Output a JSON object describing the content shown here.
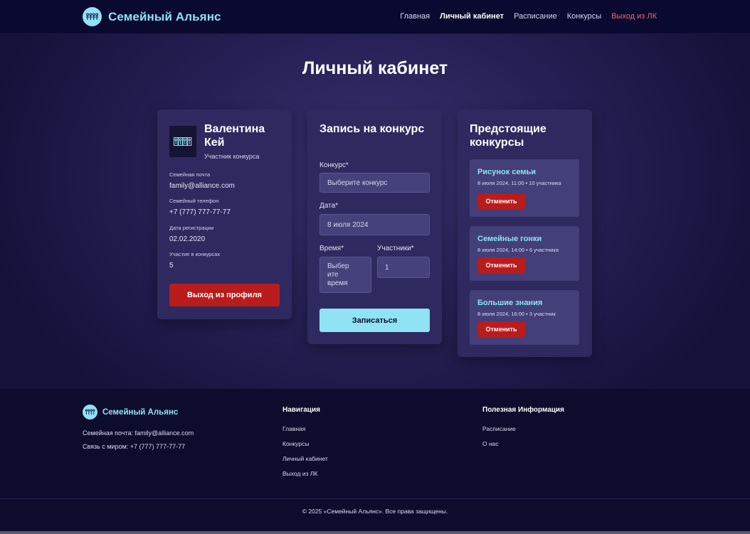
{
  "brand": {
    "name": "Семейный Альянс",
    "logo_icon": "family-group-icon",
    "accent_color": "#8fe3f5"
  },
  "nav": {
    "items": [
      {
        "label": "Главная",
        "state": "normal"
      },
      {
        "label": "Личный кабинет",
        "state": "active"
      },
      {
        "label": "Расписание",
        "state": "normal"
      },
      {
        "label": "Конкурсы",
        "state": "normal"
      },
      {
        "label": "Выход из ЛК",
        "state": "logout"
      }
    ]
  },
  "page": {
    "title": "Личный кабинет"
  },
  "profile": {
    "name": "Валентина Кей",
    "role": "Участник конкурса",
    "fields": [
      {
        "label": "Семейная почта",
        "value": "family@alliance.com"
      },
      {
        "label": "Семейный телефон",
        "value": "+7 (777) 777-77-77"
      },
      {
        "label": "Дата регистрации",
        "value": "02.02.2020"
      },
      {
        "label": "Участие в конкурсах",
        "value": "5"
      }
    ],
    "logout_button": "Выход из профиля",
    "danger_color": "#b91c1c"
  },
  "signup": {
    "heading": "Запись на конкурс",
    "contest_label": "Конкурс*",
    "contest_placeholder": "Выберите конкурс",
    "date_label": "Дата*",
    "date_value": "8 июля 2024",
    "time_label": "Время*",
    "time_placeholder": "Выбер ите время",
    "participants_label": "Участники*",
    "participants_value": "1",
    "submit_button": "Записаться"
  },
  "upcoming": {
    "heading": "Предстоящие конкурсы",
    "events": [
      {
        "title": "Рисунок семьи",
        "meta": "8 июля 2024, 11:00 • 10 участника",
        "button": "Отменить"
      },
      {
        "title": "Семейные гонки",
        "meta": "8 июля 2024, 14:00 • 6 участника",
        "button": "Отменить"
      },
      {
        "title": "Большие знания",
        "meta": "8 июля 2024, 16:00 • 3 участник",
        "button": "Отменить"
      }
    ]
  },
  "footer": {
    "brand": "Семейный Альянс",
    "email_line": "Семейная почта: family@alliance.com",
    "phone_line": "Связь с миром: +7 (777) 777-77-77",
    "nav_title": "Навигация",
    "nav_links": [
      "Главная",
      "Конкурсы",
      "Личный кабинет",
      "Выход из ЛК"
    ],
    "info_title": "Полезная Информация",
    "info_links": [
      "Расписание",
      "О нас"
    ],
    "copyright": "© 2025 «Семейный Альянс». Все права защищены."
  }
}
